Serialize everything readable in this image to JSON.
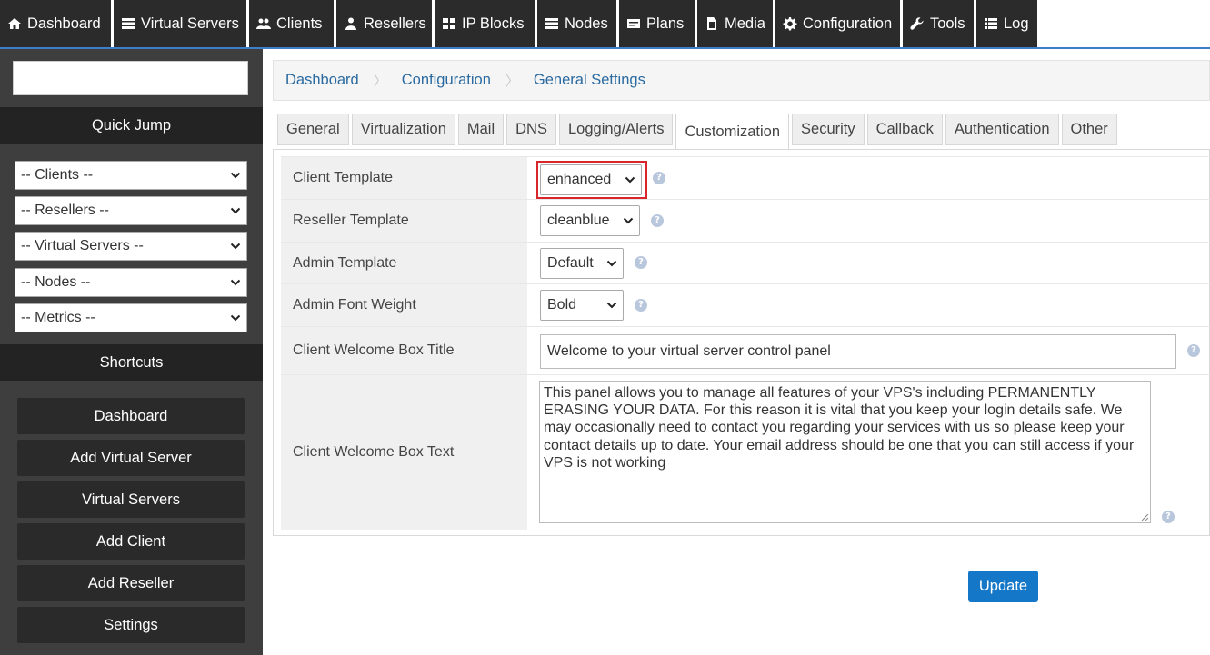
{
  "nav": {
    "items": [
      {
        "label": "Dashboard",
        "icon": "home-icon"
      },
      {
        "label": "Virtual Servers",
        "icon": "server-icon"
      },
      {
        "label": "Clients",
        "icon": "users-icon"
      },
      {
        "label": "Resellers",
        "icon": "user-icon"
      },
      {
        "label": "IP Blocks",
        "icon": "grid-icon"
      },
      {
        "label": "Nodes",
        "icon": "server-icon"
      },
      {
        "label": "Plans",
        "icon": "card-icon"
      },
      {
        "label": "Media",
        "icon": "file-media-icon"
      },
      {
        "label": "Configuration",
        "icon": "gear-icon"
      },
      {
        "label": "Tools",
        "icon": "wrench-icon"
      },
      {
        "label": "Log",
        "icon": "list-icon"
      }
    ]
  },
  "sidebar": {
    "search_value": "",
    "quick_jump": "Quick Jump",
    "selects": [
      "-- Clients --",
      "-- Resellers --",
      "-- Virtual Servers --",
      "-- Nodes --",
      "-- Metrics --"
    ],
    "shortcuts": "Shortcuts",
    "buttons": [
      "Dashboard",
      "Add Virtual Server",
      "Virtual Servers",
      "Add Client",
      "Add Reseller",
      "Settings"
    ]
  },
  "breadcrumb": [
    "Dashboard",
    "Configuration",
    "General Settings"
  ],
  "tabs": [
    "General",
    "Virtualization",
    "Mail",
    "DNS",
    "Logging/Alerts",
    "Customization",
    "Security",
    "Callback",
    "Authentication",
    "Other"
  ],
  "active_tab": "Customization",
  "form": {
    "client_template": {
      "label": "Client Template",
      "value": "enhanced"
    },
    "reseller_template": {
      "label": "Reseller Template",
      "value": "cleanblue"
    },
    "admin_template": {
      "label": "Admin Template",
      "value": "Default"
    },
    "admin_font_weight": {
      "label": "Admin Font Weight",
      "value": "Bold"
    },
    "welcome_title": {
      "label": "Client Welcome Box Title",
      "value": "Welcome to your virtual server control panel"
    },
    "welcome_text": {
      "label": "Client Welcome Box Text",
      "value": "This panel allows you to manage all features of your VPS's including PERMANENTLY ERASING YOUR DATA. For this reason it is vital that you keep your login details safe. We may occasionally need to contact you regarding your services with us so please keep your contact details up to date. Your email address should be one that you can still access if your VPS is not working"
    }
  },
  "update_label": "Update",
  "help_glyph": "?",
  "colors": {
    "accent": "#1577c7",
    "nav_bg": "#2b2b2b",
    "sidebar_bg": "#3e3e3e",
    "highlight": "#d9262a"
  }
}
